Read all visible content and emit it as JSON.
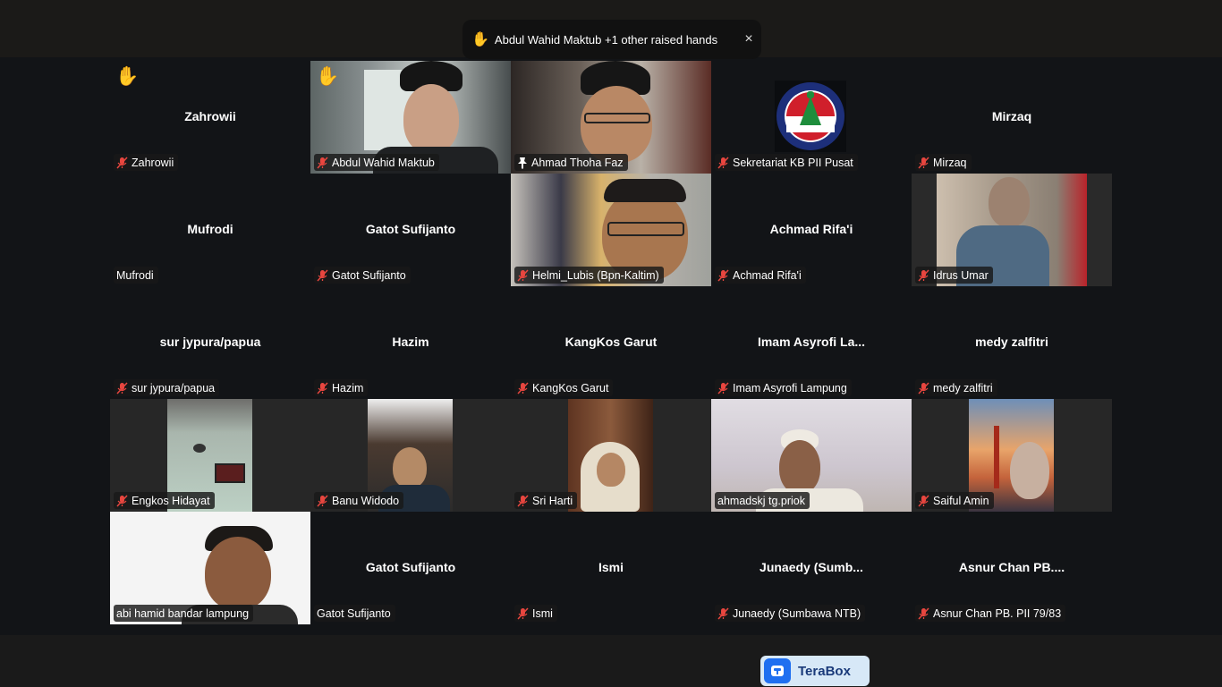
{
  "toast": {
    "message": "Abdul Wahid Maktub +1 other raised hands",
    "hand_icon": "raised-hand-icon",
    "close_symbol": "×"
  },
  "brand": {
    "label": "TeraBox"
  },
  "accent": {
    "active_speaker": "#2ec36d",
    "muted": "#e8463f",
    "raise": "#f5b82e"
  },
  "participants": [
    {
      "name": "Zahrowii",
      "display": "Zahrowii",
      "muted": true
    },
    {
      "name": "Abdul Wahid Maktub",
      "display": "",
      "muted": true
    },
    {
      "name": "Ahmad Thoha Faz",
      "display": "",
      "muted": false
    },
    {
      "name": "Sekretariat KB PII Pusat",
      "display": "",
      "muted": true
    },
    {
      "name": "Mirzaq",
      "display": "Mirzaq",
      "muted": true
    },
    {
      "name": "Mufrodi",
      "display": "Mufrodi",
      "muted": false
    },
    {
      "name": "Gatot Sufijanto",
      "display": "Gatot Sufijanto",
      "muted": true
    },
    {
      "name": "Helmi_Lubis (Bpn-Kaltim)",
      "display": "",
      "muted": true
    },
    {
      "name": "Achmad Rifa'i",
      "display": "Achmad Rifa'i",
      "muted": true
    },
    {
      "name": "Idrus Umar",
      "display": "",
      "muted": true
    },
    {
      "name": "sur jypura/papua",
      "display": "sur jypura/papua",
      "muted": true
    },
    {
      "name": "Hazim",
      "display": "Hazim",
      "muted": true
    },
    {
      "name": "KangKos Garut",
      "display": "KangKos Garut",
      "muted": true
    },
    {
      "name": "Imam Asyrofi Lampung",
      "display": "Imam Asyrofi La...",
      "muted": true
    },
    {
      "name": "medy zalfitri",
      "display": "medy zalfitri",
      "muted": true
    },
    {
      "name": "Engkos Hidayat",
      "display": "",
      "muted": true
    },
    {
      "name": "Banu Widodo",
      "display": "",
      "muted": true
    },
    {
      "name": "Sri Harti",
      "display": "",
      "muted": true
    },
    {
      "name": "ahmadskj tg.priok",
      "display": "",
      "muted": false
    },
    {
      "name": "Saiful Amin",
      "display": "",
      "muted": true
    },
    {
      "name": "abi hamid bandar lampung",
      "display": "",
      "muted": false
    },
    {
      "name": "Gatot Sufijanto",
      "display": "Gatot Sufijanto",
      "muted": false
    },
    {
      "name": "Ismi",
      "display": "Ismi",
      "muted": true
    },
    {
      "name": "Junaedy (Sumbawa NTB)",
      "display": "Junaedy  (Sumb...",
      "muted": true
    },
    {
      "name": "Asnur Chan PB.  PII 79/83",
      "display": "Asnur Chan PB....",
      "muted": true
    }
  ]
}
